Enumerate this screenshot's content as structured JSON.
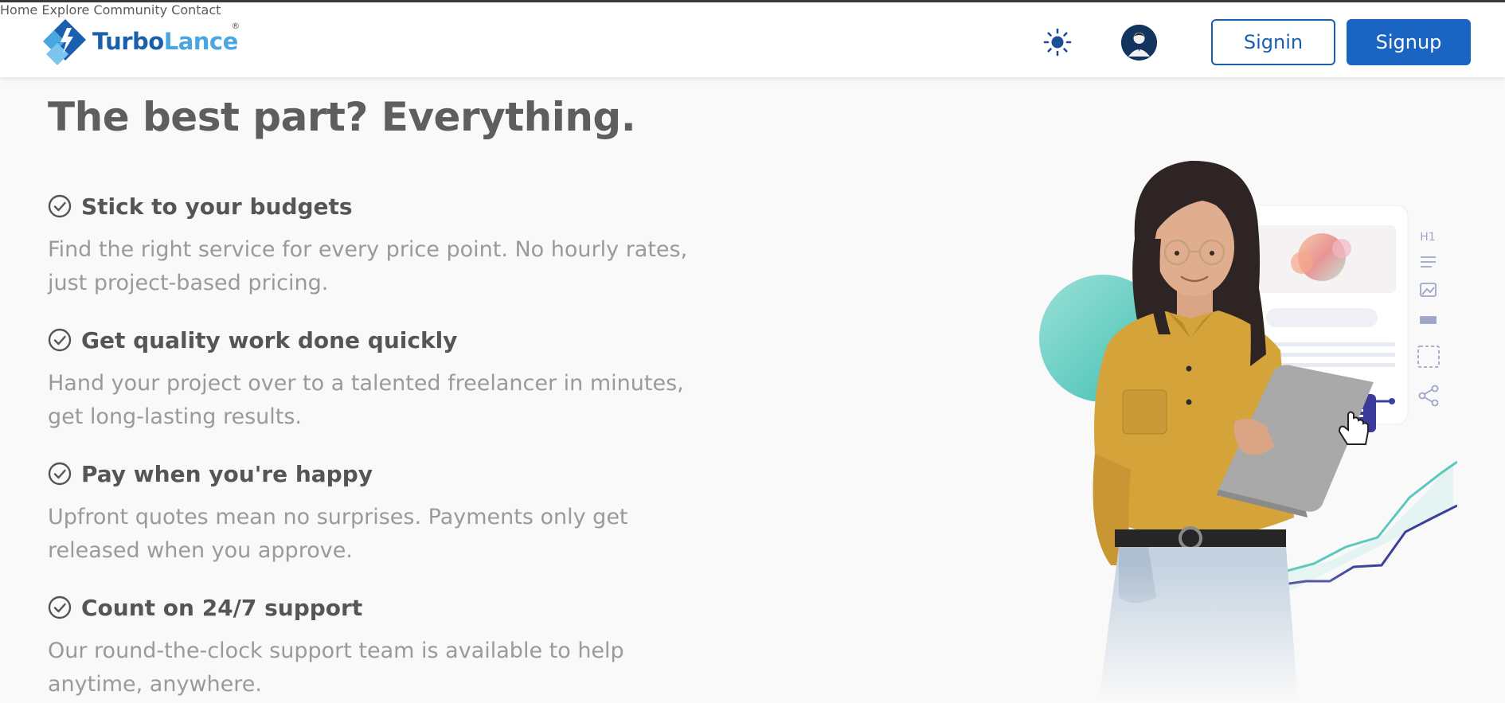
{
  "header": {
    "logo": {
      "part1": "Turbo",
      "part2": "Lance",
      "reg": "®",
      "icon": "turbolance-logo-icon"
    },
    "nav": [
      {
        "label": "Home"
      },
      {
        "label": "Explore Community"
      },
      {
        "label": "Contact"
      }
    ],
    "theme_toggle_icon": "sun-icon",
    "avatar_icon": "user-avatar-icon",
    "signin_label": "Signin",
    "signup_label": "Signup"
  },
  "main": {
    "headline": "The best part? Everything.",
    "features": [
      {
        "title": "Stick to your budgets",
        "desc": "Find the right service for every price point. No hourly rates, just project-based pricing.",
        "icon": "check-circle-icon"
      },
      {
        "title": "Get quality work done quickly",
        "desc": "Hand your project over to a talented freelancer in minutes, get long-lasting results.",
        "icon": "check-circle-icon"
      },
      {
        "title": "Pay when you're happy",
        "desc": "Upfront quotes mean no surprises. Payments only get released when you approve.",
        "icon": "check-circle-icon"
      },
      {
        "title": "Count on 24/7 support",
        "desc": "Our round-the-clock support team is available to help anytime, anywhere.",
        "icon": "check-circle-icon"
      }
    ],
    "hero_card_tag": "H1"
  },
  "colors": {
    "brand_dark": "#1a5fad",
    "brand_light": "#49a6e0",
    "nav_text": "#1b4f94",
    "signup_bg": "#1a64c2",
    "teal": "#5cc8bd",
    "indigo": "#3c3f9b"
  }
}
